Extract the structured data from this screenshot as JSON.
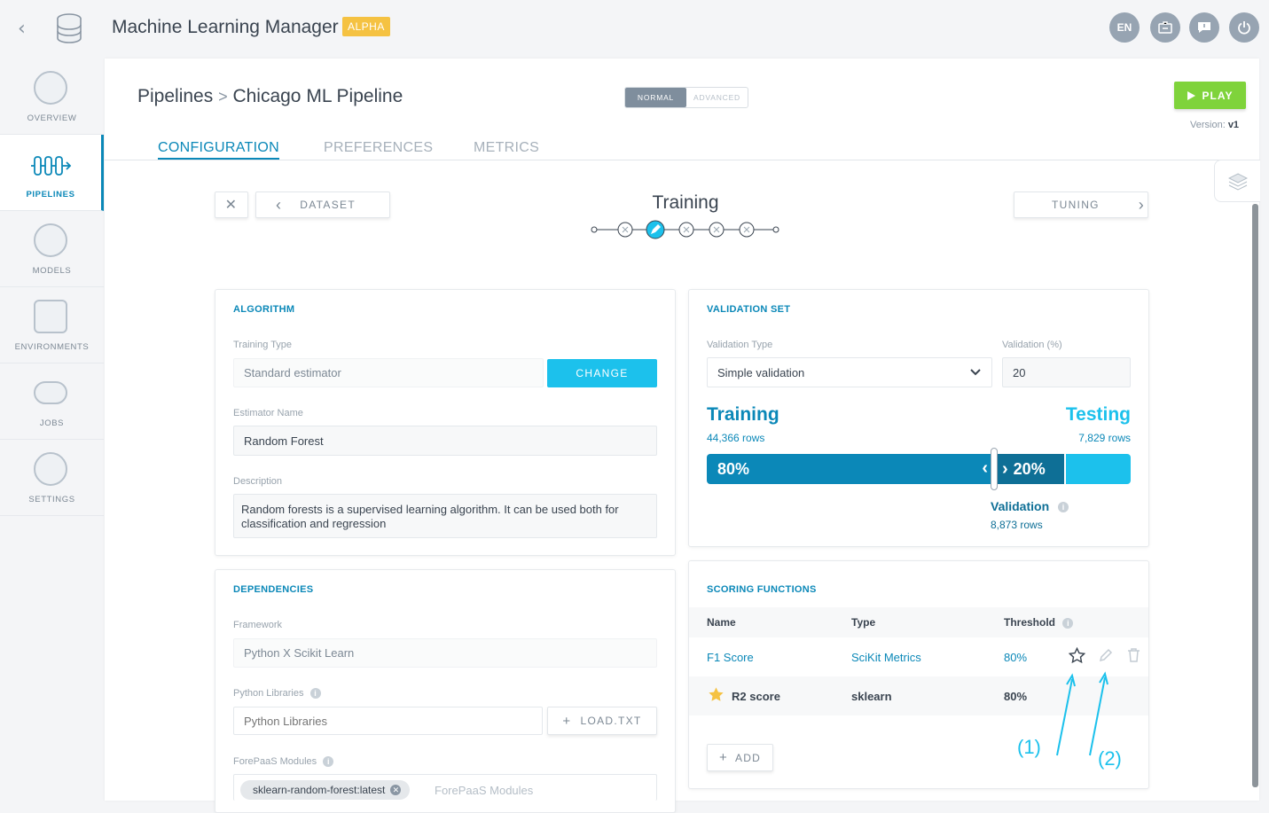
{
  "header": {
    "app_title": "Machine Learning Manager",
    "badge": "ALPHA",
    "lang": "EN"
  },
  "sidebar": {
    "items": [
      {
        "label": "OVERVIEW",
        "icon": "dashboard-icon"
      },
      {
        "label": "PIPELINES",
        "icon": "pipeline-icon",
        "active": true
      },
      {
        "label": "MODELS",
        "icon": "atom-icon"
      },
      {
        "label": "ENVIRONMENTS",
        "icon": "cube-icon"
      },
      {
        "label": "JOBS",
        "icon": "gears-icon"
      },
      {
        "label": "SETTINGS",
        "icon": "settings-icon"
      }
    ]
  },
  "breadcrumb": {
    "root": "Pipelines",
    "separator": ">",
    "current": "Chicago ML Pipeline"
  },
  "mode_switch": {
    "normal": "NORMAL",
    "advanced": "ADVANCED"
  },
  "play": {
    "label": "PLAY",
    "version_label": "Version:",
    "version": "v1"
  },
  "tabs": [
    "CONFIGURATION",
    "PREFERENCES",
    "METRICS"
  ],
  "stepper": {
    "prev": "DATASET",
    "title": "Training",
    "next": "TUNING"
  },
  "algorithm": {
    "title": "ALGORITHM",
    "training_type_label": "Training Type",
    "training_type": "Standard estimator",
    "change": "CHANGE",
    "estimator_label": "Estimator Name",
    "estimator": "Random Forest",
    "description_label": "Description",
    "description": "Random forests is a supervised learning algorithm. It can be used both for classification and regression"
  },
  "dependencies": {
    "title": "DEPENDENCIES",
    "framework_label": "Framework",
    "framework": "Python X Scikit Learn",
    "libs_label": "Python Libraries",
    "libs_placeholder": "Python Libraries",
    "load": "LOAD.TXT",
    "modules_label": "ForePaaS Modules",
    "module_chip": "sklearn-random-forest:latest",
    "modules_placeholder": "ForePaaS Modules"
  },
  "validation": {
    "title": "VALIDATION SET",
    "type_label": "Validation Type",
    "type": "Simple validation",
    "pct_label": "Validation (%)",
    "pct": "20",
    "training": "Training",
    "training_rows": "44,366 rows",
    "testing": "Testing",
    "testing_rows": "7,829 rows",
    "train_pct": "80%",
    "valid_pct": "20%",
    "validation": "Validation",
    "validation_rows": "8,873 rows"
  },
  "scoring": {
    "title": "SCORING FUNCTIONS",
    "headers": [
      "Name",
      "Type",
      "Threshold"
    ],
    "rows": [
      {
        "name": "F1 Score",
        "type": "SciKit Metrics",
        "threshold": "80%"
      },
      {
        "name": "R2 score",
        "type": "sklearn",
        "threshold": "80%"
      }
    ],
    "add": "ADD"
  },
  "annotations": [
    "(1)",
    "(2)"
  ],
  "colors": {
    "accent": "#0b88b8",
    "cyan": "#1cc1ec",
    "play": "#7fd33b",
    "alpha": "#f5c242"
  }
}
